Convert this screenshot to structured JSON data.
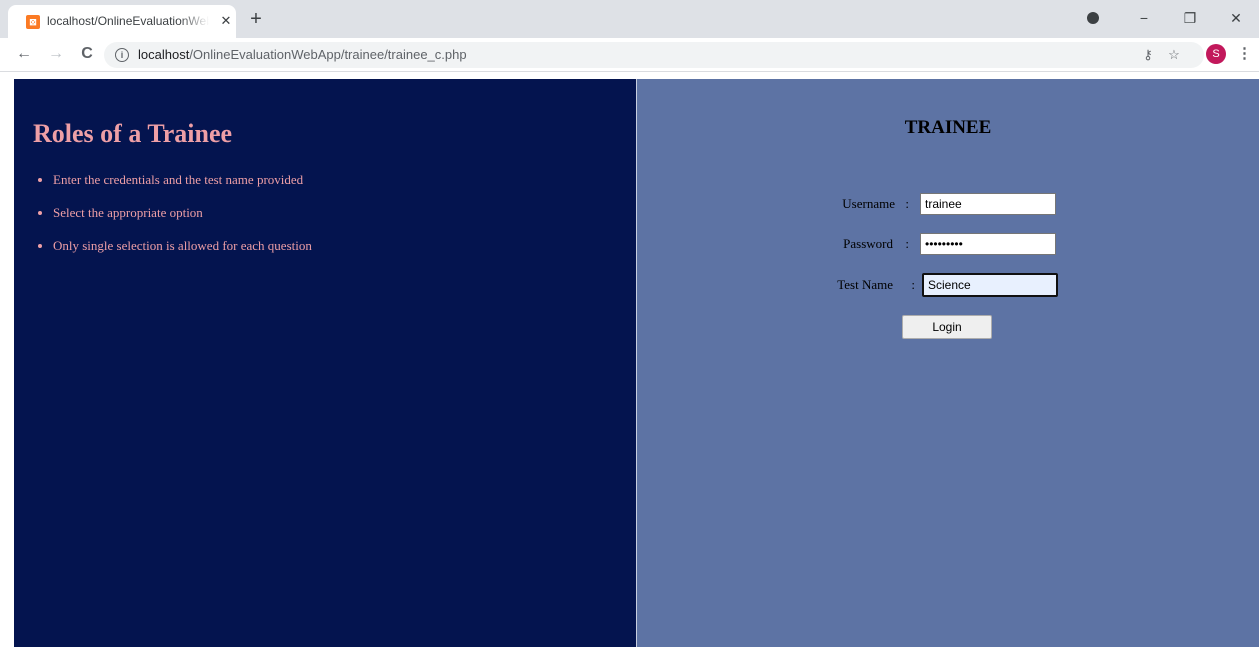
{
  "browser": {
    "tab_title": "localhost/OnlineEvaluationWebApp/trainee/trainee_c.php",
    "favicon_text": "⊠",
    "tab_close": "✕",
    "new_tab": "+",
    "url_host": "localhost",
    "url_path": "/OnlineEvaluationWebApp/trainee/trainee_c.php",
    "profile_initial": "S",
    "back": "←",
    "forward": "→",
    "reload": "C",
    "key_icon": "⚷",
    "star_icon": "☆",
    "menu_icon": "⋮",
    "minimize": "−",
    "restore": "❐",
    "close": "✕"
  },
  "left": {
    "title": "Roles of a Trainee",
    "roles": [
      "Enter the credentials and the test name provided",
      "Select the appropriate option",
      "Only single selection is allowed for each question"
    ]
  },
  "right": {
    "title": "TRAINEE",
    "username_label": "Username",
    "password_label": "Password",
    "testname_label": "Test Name",
    "separator": ":",
    "username_value": "trainee",
    "password_value": "•••••••••",
    "testname_value": "Science",
    "login_label": "Login"
  },
  "colors": {
    "left_bg": "#04144f",
    "right_bg": "#5d73a4",
    "accent_text": "#ee9fa6"
  }
}
